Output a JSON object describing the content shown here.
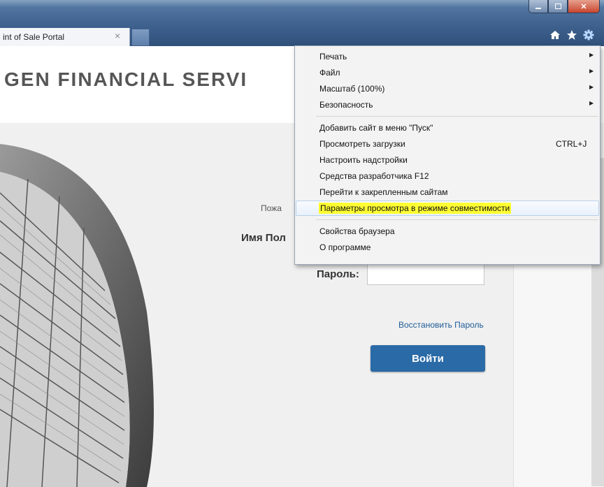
{
  "browser": {
    "tab_title": "int of Sale Portal",
    "tab_close": "×"
  },
  "page": {
    "brand": "GEN FINANCIAL SERVI",
    "greeting": "Пожа",
    "username_label": "Имя Пол",
    "password_label": "Пароль:",
    "recover_link": "Восстановить Пароль",
    "login_button": "Войти"
  },
  "menu": {
    "items": [
      {
        "label": "Печать",
        "submenu": true
      },
      {
        "label": "Файл",
        "submenu": true
      },
      {
        "label": "Масштаб (100%)",
        "submenu": true
      },
      {
        "label": "Безопасность",
        "submenu": true
      },
      {
        "label": "Добавить сайт в меню \"Пуск\""
      },
      {
        "label": "Просмотреть загрузки",
        "shortcut": "CTRL+J"
      },
      {
        "label": "Настроить надстройки"
      },
      {
        "label": "Средства разработчика F12"
      },
      {
        "label": "Перейти к закрепленным сайтам"
      },
      {
        "label": "Параметры просмотра в режиме совместимости",
        "highlighted": true
      },
      {
        "label": "Свойства браузера"
      },
      {
        "label": "О программе"
      }
    ]
  },
  "colors": {
    "accent_button": "#2a6aa6",
    "highlight": "#ffff33",
    "link": "#1f5c96"
  },
  "icons": [
    "home-icon",
    "favorites-star-icon",
    "tools-gear-icon",
    "minimize-icon",
    "maximize-icon",
    "close-icon"
  ]
}
